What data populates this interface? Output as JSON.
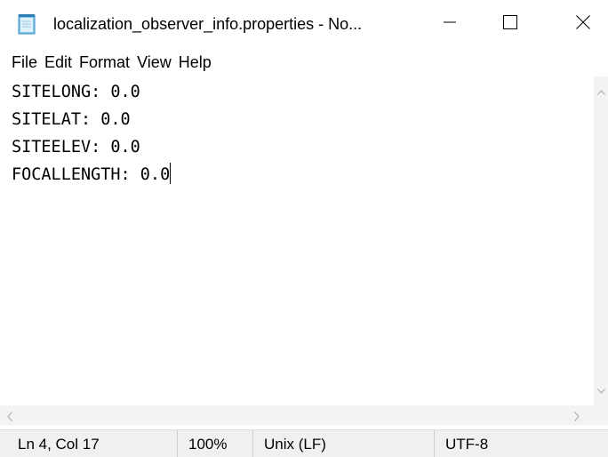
{
  "window": {
    "title": "localization_observer_info.properties - No...",
    "icon": "notepad-icon",
    "controls": {
      "minimize": "minimize-icon",
      "maximize": "maximize-icon",
      "close": "close-icon"
    }
  },
  "menu": {
    "items": [
      {
        "label": "File"
      },
      {
        "label": "Edit"
      },
      {
        "label": "Format"
      },
      {
        "label": "View"
      },
      {
        "label": "Help"
      }
    ]
  },
  "editor": {
    "lines": [
      "SITELONG: 0.0",
      "SITELAT: 0.0",
      "SITEELEV: 0.0",
      "FOCALLENGTH: 0.0"
    ]
  },
  "status": {
    "position": "Ln 4, Col 17",
    "zoom": "100%",
    "line_ending": "Unix (LF)",
    "encoding": "UTF-8"
  },
  "colors": {
    "background": "#ffffff",
    "scrollbar": "#f3f3f3",
    "statusbar": "#f0f0f0",
    "text": "#000000"
  }
}
